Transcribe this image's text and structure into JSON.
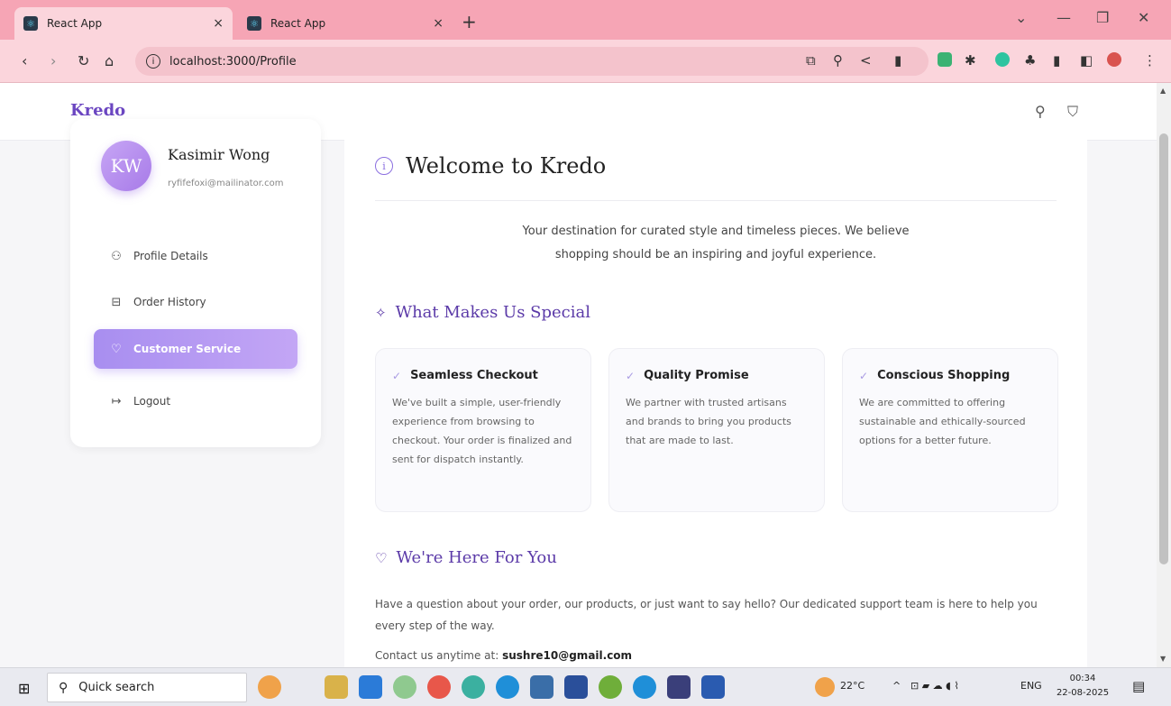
{
  "browser": {
    "tabs": [
      {
        "title": "React App",
        "close": "×"
      },
      {
        "title": "React App",
        "close": "×"
      }
    ],
    "new_tab": "+",
    "url": "localhost:3000/Profile",
    "window_controls": {
      "chevron": "⌄",
      "minimize": "—",
      "restore": "❐",
      "close": "✕"
    }
  },
  "site": {
    "brand": "Kredo"
  },
  "sidebar": {
    "avatar_initials": "KW",
    "user_name": "Kasimir Wong",
    "user_email": "ryfifefoxi@mailinator.com",
    "items": [
      {
        "label": "Profile Details",
        "icon": "user-icon",
        "active": false
      },
      {
        "label": "Order History",
        "icon": "shopping-bag-icon",
        "active": false
      },
      {
        "label": "Customer Service",
        "icon": "heart-icon",
        "active": true
      },
      {
        "label": "Logout",
        "icon": "logout-icon",
        "active": false
      }
    ]
  },
  "content": {
    "title": "Welcome to Kredo",
    "intro_line1": "Your destination for curated style and timeless pieces. We believe",
    "intro_line2": "shopping should be an inspiring and joyful experience.",
    "special_title": "What Makes Us Special",
    "cards": [
      {
        "title": "Seamless Checkout",
        "text": "We've built a simple, user-friendly experience from browsing to checkout. Your order is finalized and sent for dispatch instantly."
      },
      {
        "title": "Quality Promise",
        "text": "We partner with trusted artisans and brands to bring you products that are made to last."
      },
      {
        "title": "Conscious Shopping",
        "text": "We are committed to offering sustainable and ethically-sourced options for a better future."
      }
    ],
    "support_title": "We're Here For You",
    "support_text": "Have a question about your order, our products, or just want to say hello? Our dedicated support team is here to help you every step of the way.",
    "contact_prefix": "Contact us anytime at:",
    "contact_email": "sushre10@gmail.com"
  },
  "taskbar": {
    "search_label": "Quick search",
    "temperature": "22°C",
    "language": "ENG",
    "time": "00:34",
    "date": "22-08-2025"
  },
  "colors": {
    "accent": "#8b6fe0",
    "brand": "#6b46c1",
    "tab_bar": "#f6a5b5"
  }
}
